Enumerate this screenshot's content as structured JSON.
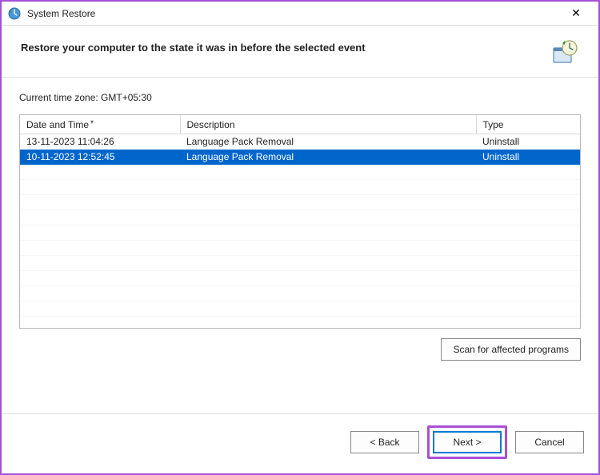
{
  "window": {
    "title": "System Restore",
    "close_glyph": "✕"
  },
  "header": {
    "heading": "Restore your computer to the state it was in before the selected event"
  },
  "content": {
    "timezone_label": "Current time zone: GMT+05:30",
    "columns": {
      "datetime": "Date and Time",
      "description": "Description",
      "type": "Type"
    },
    "rows": [
      {
        "datetime": "13-11-2023 11:04:26",
        "description": "Language Pack Removal",
        "type": "Uninstall",
        "selected": false
      },
      {
        "datetime": "10-11-2023 12:52:45",
        "description": "Language Pack Removal",
        "type": "Uninstall",
        "selected": true
      }
    ],
    "scan_button": "Scan for affected programs"
  },
  "footer": {
    "back": "< Back",
    "next": "Next >",
    "cancel": "Cancel"
  }
}
